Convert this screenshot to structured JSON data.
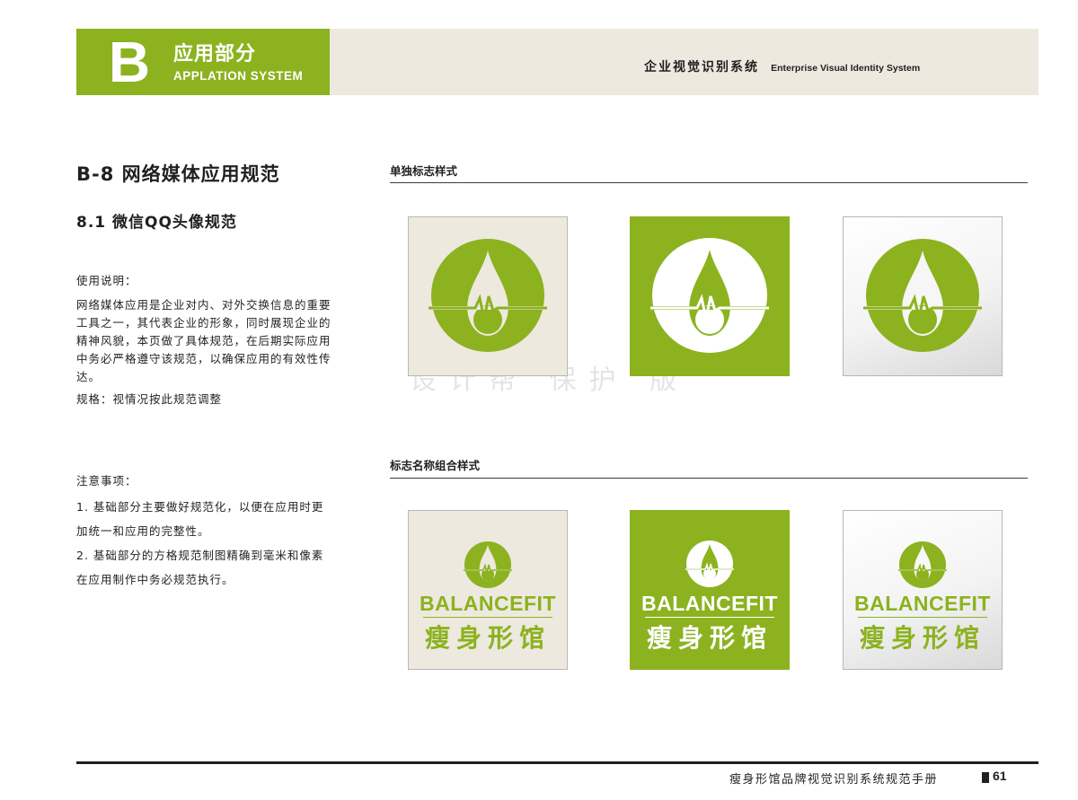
{
  "header": {
    "letter": "B",
    "title": "应用部分",
    "subtitle": "APPLATION SYSTEM",
    "system_cn": "企业视觉识别系统",
    "system_en": "Enterprise Visual Identity System"
  },
  "section": {
    "title": "B-8  网络媒体应用规范",
    "subtitle": "8.1  微信QQ头像规范"
  },
  "usage": {
    "label": "使用说明：",
    "body": "网络媒体应用是企业对内、对外交换信息的重要工具之一，其代表企业的形象，同时展现企业的精神风貌，本页做了具体规范，在后期实际应用中务必严格遵守该规范，以确保应用的有效性传达。",
    "spec": "规格：视情况按此规范调整"
  },
  "notes": {
    "label": "注意事项：",
    "items": [
      "1. 基础部分主要做好规范化，以便在应用时更加统一和应用的完整性。",
      "2. 基础部分的方格规范制图精确到毫米和像素在应用制作中务必规范执行。"
    ]
  },
  "logo_section": {
    "single_label": "单独标志样式",
    "combo_label": "标志名称组合样式"
  },
  "brand": {
    "name_en": "BALANCEFIT",
    "name_cn": "瘦身形馆"
  },
  "colors": {
    "brand_green": "#8cb21f",
    "cream": "#ede9df",
    "dark": "#231f20"
  },
  "watermark": "设计帮 保护 版",
  "footer": {
    "text": "瘦身形馆品牌视觉识别系统规范手册",
    "page": "61"
  }
}
